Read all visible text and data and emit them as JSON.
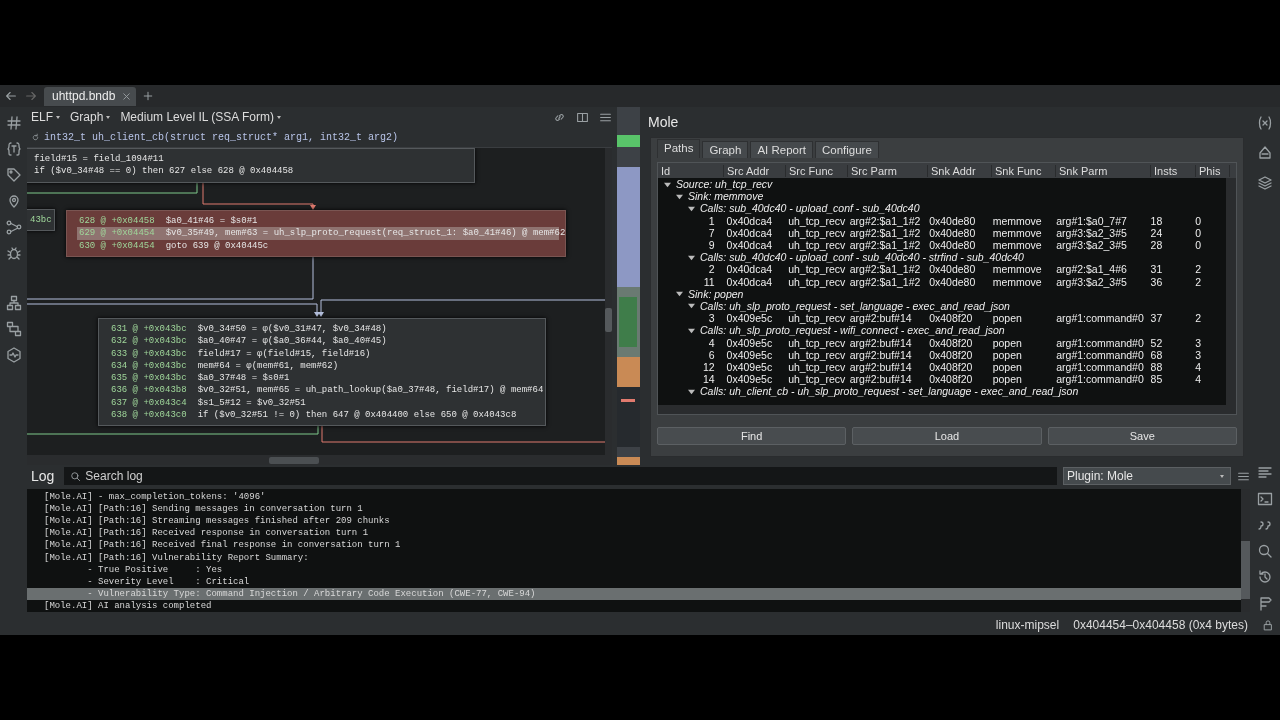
{
  "tabs": [
    {
      "label": "uhttpd.bndb",
      "selected": true
    }
  ],
  "graph_view": {
    "menus": [
      "ELF",
      "Graph",
      "Medium Level IL (SSA Form)"
    ],
    "signature": "int32_t uh_client_cb(struct req_struct* arg1, int32_t arg2)",
    "blocks": [
      {
        "highlighted": false,
        "lines": [
          {
            "code": "field#15 = field_1094#11",
            "selected": false
          },
          {
            "code": "if ($v0_34#48 == 0) then 627 else 628 @ 0x404458",
            "selected": false
          }
        ]
      },
      {
        "highlighted": false,
        "lines": [
          {
            "address": "43bc",
            "selected": false
          }
        ]
      },
      {
        "highlighted": true,
        "lines": [
          {
            "address": "628 @ +0x04458",
            "code": "$a0_41#46 = $s0#1",
            "selected": false
          },
          {
            "address": "629 @ +0x04454",
            "code": "$v0_35#49, mem#63 = uh_slp_proto_request(req_struct_1: $a0_41#46) @ mem#62",
            "selected": true
          },
          {
            "address": "630 @ +0x04454",
            "code": "goto 639 @ 0x40445c",
            "selected": false
          }
        ]
      },
      {
        "highlighted": false,
        "lines": [
          {
            "address": "631 @ +0x043bc",
            "code": "$v0_34#50 = φ($v0_31#47, $v0_34#48)",
            "selected": false
          },
          {
            "address": "632 @ +0x043bc",
            "code": "$a0_40#47 = φ($a0_36#44, $a0_40#45)",
            "selected": false
          },
          {
            "address": "633 @ +0x043bc",
            "code": "field#17 = φ(field#15, field#16)",
            "selected": false
          },
          {
            "address": "634 @ +0x043bc",
            "code": "mem#64 = φ(mem#61, mem#62)",
            "selected": false
          },
          {
            "address": "635 @ +0x043bc",
            "code": "$a0_37#48 = $s0#1",
            "selected": false
          },
          {
            "address": "636 @ +0x043b8",
            "code": "$v0_32#51, mem#65 = uh_path_lookup($a0_37#48, field#17) @ mem#64",
            "selected": false
          },
          {
            "address": "637 @ +0x043c4",
            "code": "$s1_5#12 = $v0_32#51",
            "selected": false
          },
          {
            "address": "638 @ +0x043c0",
            "code": "if ($v0_32#51 != 0) then 647 @ 0x404400 else 650 @ 0x4043c8",
            "selected": false
          }
        ]
      }
    ]
  },
  "mole": {
    "title": "Mole",
    "tabs": [
      {
        "label": "Paths",
        "selected": true
      },
      {
        "label": "Graph",
        "selected": false
      },
      {
        "label": "AI Report",
        "selected": false
      },
      {
        "label": "Configure",
        "selected": false
      }
    ],
    "columns": [
      "Id",
      "Src Addr",
      "Src Func",
      "Src Parm",
      "Snk Addr",
      "Snk Func",
      "Snk Parm",
      "Insts",
      "Phis"
    ],
    "tree": [
      {
        "kind": "group",
        "label": "Source: uh_tcp_recv",
        "expanded": true,
        "children": [
          {
            "kind": "group",
            "label": "Sink: memmove",
            "expanded": true,
            "children": [
              {
                "kind": "group",
                "label": "Calls: sub_40dc40 - upload_conf - sub_40dc40",
                "expanded": true,
                "children": [
                  {
                    "kind": "row",
                    "cells": [
                      "1",
                      "0x40dca4",
                      "uh_tcp_recv",
                      "arg#2:$a1_1#2",
                      "0x40de80",
                      "memmove",
                      "arg#1:$a0_7#7",
                      "18",
                      "0"
                    ]
                  },
                  {
                    "kind": "row",
                    "cells": [
                      "7",
                      "0x40dca4",
                      "uh_tcp_recv",
                      "arg#2:$a1_1#2",
                      "0x40de80",
                      "memmove",
                      "arg#3:$a2_3#5",
                      "24",
                      "0"
                    ]
                  },
                  {
                    "kind": "row",
                    "cells": [
                      "9",
                      "0x40dca4",
                      "uh_tcp_recv",
                      "arg#2:$a1_1#2",
                      "0x40de80",
                      "memmove",
                      "arg#3:$a2_3#5",
                      "28",
                      "0"
                    ]
                  }
                ]
              },
              {
                "kind": "group",
                "label": "Calls: sub_40dc40 - upload_conf - sub_40dc40 - strfind - sub_40dc40",
                "expanded": true,
                "children": [
                  {
                    "kind": "row",
                    "cells": [
                      "2",
                      "0x40dca4",
                      "uh_tcp_recv",
                      "arg#2:$a1_1#2",
                      "0x40de80",
                      "memmove",
                      "arg#2:$a1_4#6",
                      "31",
                      "2"
                    ]
                  },
                  {
                    "kind": "row",
                    "cells": [
                      "11",
                      "0x40dca4",
                      "uh_tcp_recv",
                      "arg#2:$a1_1#2",
                      "0x40de80",
                      "memmove",
                      "arg#3:$a2_3#5",
                      "36",
                      "2"
                    ]
                  }
                ]
              }
            ]
          },
          {
            "kind": "group",
            "label": "Sink: popen",
            "expanded": true,
            "children": [
              {
                "kind": "group",
                "label": "Calls: uh_slp_proto_request - set_language - exec_and_read_json",
                "expanded": true,
                "children": [
                  {
                    "kind": "row",
                    "cells": [
                      "3",
                      "0x409e5c",
                      "uh_tcp_recv",
                      "arg#2:buf#14",
                      "0x408f20",
                      "popen",
                      "arg#1:command#0",
                      "37",
                      "2"
                    ]
                  }
                ]
              },
              {
                "kind": "group",
                "label": "Calls: uh_slp_proto_request - wifi_connect - exec_and_read_json",
                "expanded": true,
                "children": [
                  {
                    "kind": "row",
                    "cells": [
                      "4",
                      "0x409e5c",
                      "uh_tcp_recv",
                      "arg#2:buf#14",
                      "0x408f20",
                      "popen",
                      "arg#1:command#0",
                      "52",
                      "3"
                    ]
                  },
                  {
                    "kind": "row",
                    "cells": [
                      "6",
                      "0x409e5c",
                      "uh_tcp_recv",
                      "arg#2:buf#14",
                      "0x408f20",
                      "popen",
                      "arg#1:command#0",
                      "68",
                      "3"
                    ]
                  },
                  {
                    "kind": "row",
                    "cells": [
                      "12",
                      "0x409e5c",
                      "uh_tcp_recv",
                      "arg#2:buf#14",
                      "0x408f20",
                      "popen",
                      "arg#1:command#0",
                      "88",
                      "4"
                    ]
                  },
                  {
                    "kind": "row",
                    "cells": [
                      "14",
                      "0x409e5c",
                      "uh_tcp_recv",
                      "arg#2:buf#14",
                      "0x408f20",
                      "popen",
                      "arg#1:command#0",
                      "85",
                      "4"
                    ]
                  }
                ]
              },
              {
                "kind": "group",
                "label": "Calls: uh_client_cb - uh_slp_proto_request - set_language - exec_and_read_json",
                "expanded": true
              }
            ]
          }
        ]
      }
    ],
    "buttons": [
      "Find",
      "Load",
      "Save"
    ]
  },
  "log": {
    "title": "Log",
    "search": {
      "placeholder": "Search log"
    },
    "filter": "Plugin: Mole",
    "lines": [
      {
        "text": "[Mole.AI] - max_completion_tokens: '4096'",
        "selected": false
      },
      {
        "text": "[Mole.AI] [Path:16] Sending messages in conversation turn 1",
        "selected": false
      },
      {
        "text": "[Mole.AI] [Path:16] Streaming messages finished after 209 chunks",
        "selected": false
      },
      {
        "text": "[Mole.AI] [Path:16] Received response in conversation turn 1",
        "selected": false
      },
      {
        "text": "[Mole.AI] [Path:16] Received final response in conversation turn 1",
        "selected": false
      },
      {
        "text": "[Mole.AI] [Path:16] Vulnerability Report Summary:",
        "selected": false
      },
      {
        "text": "        - True Positive     : Yes",
        "selected": false
      },
      {
        "text": "        - Severity Level    : Critical",
        "selected": false
      },
      {
        "text": "        - Vulnerability Type: Command Injection / Arbitrary Code Execution (CWE-77, CWE-94)",
        "selected": true
      },
      {
        "text": "[Mole.AI] AI analysis completed",
        "selected": false
      }
    ]
  },
  "status_bar": {
    "architecture": "linux-mipsel",
    "selection": "0x404454–0x404458 (0x4 bytes)"
  }
}
